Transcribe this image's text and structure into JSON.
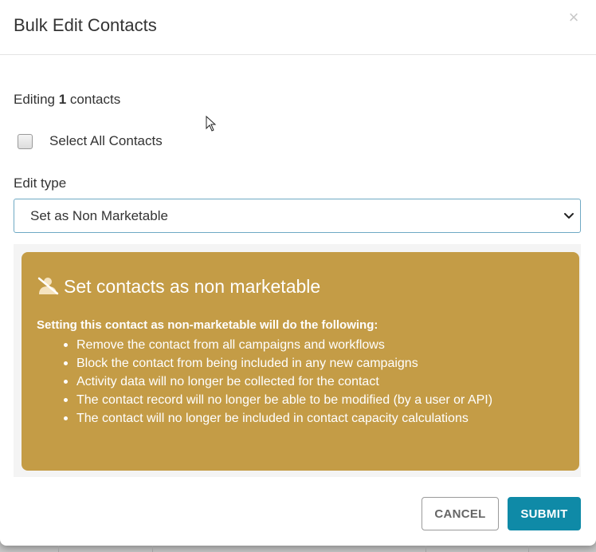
{
  "modal": {
    "title": "Bulk Edit Contacts",
    "close_label": "×"
  },
  "editing": {
    "prefix": "Editing",
    "count": "1",
    "suffix": "contacts"
  },
  "select_all": {
    "label": "Select All Contacts",
    "checked": false
  },
  "edit_type": {
    "label": "Edit type",
    "selected": "Set as Non Marketable"
  },
  "notice": {
    "icon": "non-marketable-user-icon",
    "title": "Set contacts as non marketable",
    "intro": "Setting this contact as non-marketable will do the following:",
    "items": [
      "Remove the contact from all campaigns and workflows",
      "Block the contact from being included in any new campaigns",
      "Activity data will no longer be collected for the contact",
      "The contact record will no longer be able to be modified (by a user or API)",
      "The contact will no longer be included in contact capacity calculations"
    ],
    "color": "#c49c46"
  },
  "buttons": {
    "cancel": "CANCEL",
    "submit": "SUBMIT",
    "submit_color": "#0f8aa7"
  }
}
